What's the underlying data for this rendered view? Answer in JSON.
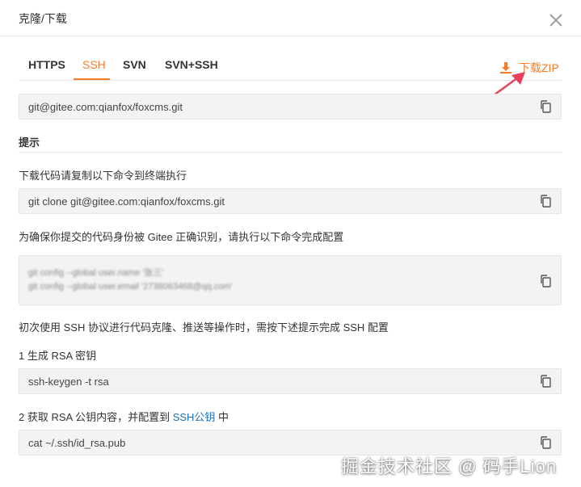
{
  "dialog": {
    "title": "克隆/下载",
    "close_icon": "close-icon"
  },
  "tabs": [
    {
      "label": "HTTPS",
      "active": false
    },
    {
      "label": "SSH",
      "active": true
    },
    {
      "label": "SVN",
      "active": false
    },
    {
      "label": "SVN+SSH",
      "active": false
    }
  ],
  "download": {
    "label": "下载ZIP",
    "icon": "download-icon",
    "color": "#f57c28"
  },
  "clone_url": "git@gitee.com:qianfox/foxcms.git",
  "hint": {
    "title": "提示",
    "step_copy_desc": "下载代码请复制以下命令到终端执行",
    "clone_command": "git clone git@gitee.com:qianfox/foxcms.git",
    "identity_desc": "为确保你提交的代码身份被 Gitee 正确识别，请执行以下命令完成配置",
    "config_lines": [
      "git config --global user.name '张三'",
      "git config --global user.email '2738063468@qq.com'"
    ],
    "ssh_first_desc": "初次使用 SSH 协议进行代码克隆、推送等操作时，需按下述提示完成 SSH 配置",
    "step1_label": "1 生成 RSA 密钥",
    "step1_command": "ssh-keygen -t rsa",
    "step2_prefix": "2 获取 RSA 公钥内容，并配置到 ",
    "step2_link": "SSH公钥",
    "step2_suffix": " 中",
    "step2_command": "cat ~/.ssh/id_rsa.pub"
  },
  "watermark": "掘金技术社区 @ 码手Lion",
  "colors": {
    "accent": "#f57c28",
    "link": "#1e6fb5",
    "annotation_arrow": "#e8415e"
  }
}
